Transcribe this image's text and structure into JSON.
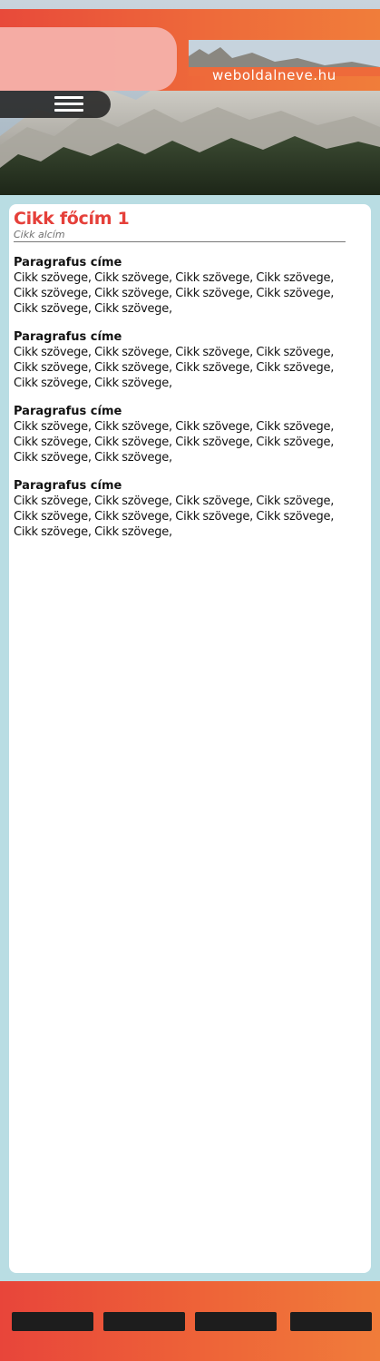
{
  "header": {
    "site_name": "weboldalneve.hu",
    "menu_icon": "hamburger-menu-icon",
    "brand_color": "#ee6438"
  },
  "article": {
    "title": "Cikk főcím 1",
    "subtitle": "Cikk alcím",
    "sections": [
      {
        "title": "Paragrafus címe",
        "body": "Cikk szövege, Cikk szövege, Cikk szövege, Cikk szö­vege, Cikk szövege, Cikk szövege, Cikk szövege, Cikk szövege, Cikk szövege, Cikk szövege,"
      },
      {
        "title": "Paragrafus címe",
        "body": "Cikk szövege, Cikk szövege, Cikk szövege, Cikk szö­vege, Cikk szövege, Cikk szövege, Cikk szövege, Cikk szövege, Cikk szövege, Cikk szövege,"
      },
      {
        "title": "Paragrafus címe",
        "body": "Cikk szövege, Cikk szövege, Cikk szövege, Cikk szö­vege, Cikk szövege, Cikk szövege, Cikk szövege, Cikk szövege, Cikk szövege, Cikk szövege,"
      },
      {
        "title": "Paragrafus címe",
        "body": "Cikk szövege, Cikk szövege, Cikk szövege, Cikk szö­vege, Cikk szövege, Cikk szövege, Cikk szövege, Cikk szövege, Cikk szövege, Cikk szövege,"
      }
    ]
  },
  "colors": {
    "title_red": "#e5403a",
    "page_background": "#b9dde3",
    "footer_button": "#1d1d1d"
  }
}
